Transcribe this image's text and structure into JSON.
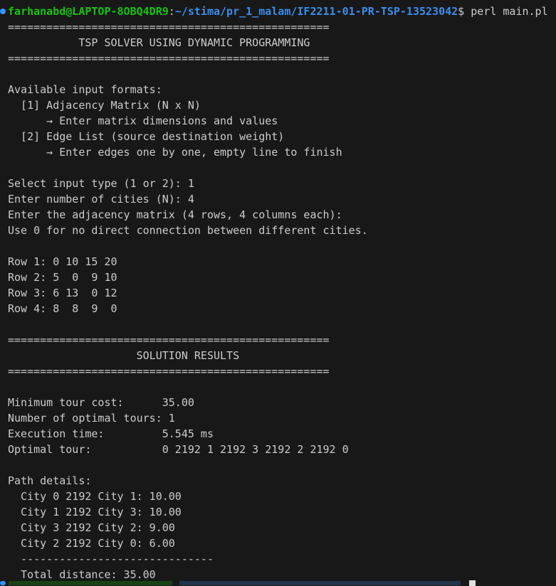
{
  "prompt": {
    "user_host": "farhanabd@LAPTOP-8OBQ4DR9",
    "colon": ":",
    "cwd": "~/stima/pr_1_malam/IF2211-01-PR-TSP-13523042",
    "symbol": "$ ",
    "command": "perl main.pl"
  },
  "colors": {
    "background": "#181818",
    "text": "#cccccc",
    "user_host": "#16c60c",
    "cwd": "#3b8eea",
    "prompt_dot": "#3794ff"
  },
  "lines": [
    "==================================================",
    "           TSP SOLVER USING DYNAMIC PROGRAMMING",
    "==================================================",
    "",
    "Available input formats:",
    "  [1] Adjacency Matrix (N x N)",
    "      → Enter matrix dimensions and values",
    "  [2] Edge List (source destination weight)",
    "      → Enter edges one by one, empty line to finish",
    "",
    "Select input type (1 or 2): 1",
    "Enter number of cities (N): 4",
    "Enter the adjacency matrix (4 rows, 4 columns each):",
    "Use 0 for no direct connection between different cities.",
    "",
    "Row 1: 0 10 15 20",
    "Row 2: 5  0  9 10",
    "Row 3: 6 13  0 12",
    "Row 4: 8  8  9  0",
    "",
    "==================================================",
    "                    SOLUTION RESULTS",
    "==================================================",
    "",
    "Minimum tour cost:      35.00",
    "Number of optimal tours: 1",
    "Execution time:         5.545 ms",
    "Optimal tour:           0 2192 1 2192 3 2192 2 2192 0",
    "",
    "Path details:",
    "  City 0 2192 City 1: 10.00",
    "  City 1 2192 City 3: 10.00",
    "  City 3 2192 City 2: 9.00",
    "  City 2 2192 City 0: 6.00",
    "  ------------------------------",
    "  Total distance: 35.00"
  ]
}
